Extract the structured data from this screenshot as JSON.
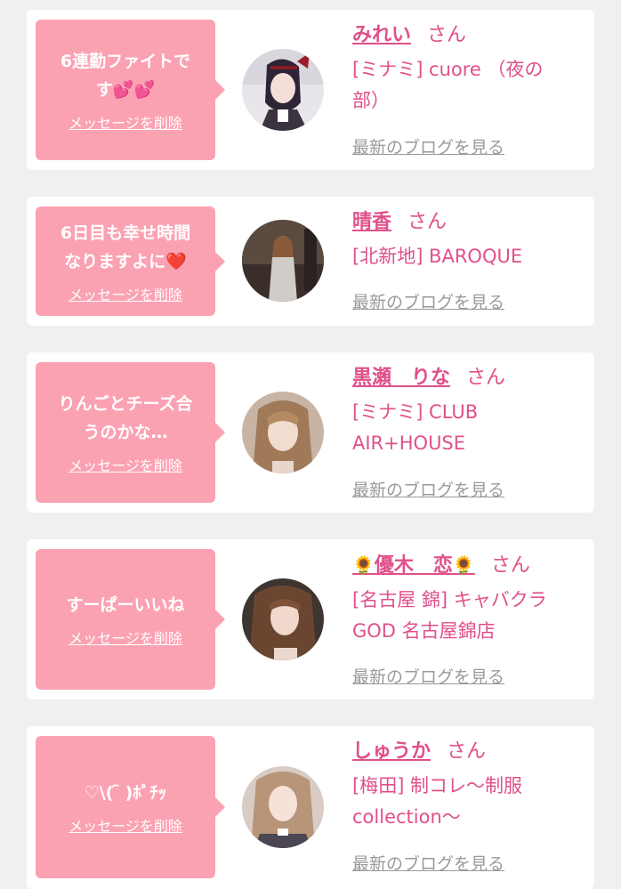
{
  "common": {
    "delete_label": "メッセージを削除",
    "blog_label": "最新のブログを見る",
    "san": "さん"
  },
  "cards": [
    {
      "message_line1": "6連勤ファイトで",
      "message_line2": "す💕💕",
      "name": "みれい",
      "shop_line1": "[ミナミ] cuore （夜の",
      "shop_line2": "部）"
    },
    {
      "message_line1": "6日目も幸せ時間",
      "message_line2": "なりますよに❤️",
      "name": "晴香",
      "shop_line1": "[北新地] BAROQUE",
      "shop_line2": ""
    },
    {
      "message_line1": "りんごとチーズ合",
      "message_line2": "うのかな…",
      "name": "黒瀬　りな",
      "shop_line1": "[ミナミ] CLUB",
      "shop_line2": "AIR+HOUSE"
    },
    {
      "message_line1": "すーぱーいいね",
      "message_line2": "",
      "name_prefix": "🌻",
      "name": "優木　恋",
      "name_suffix": "🌻",
      "shop_line1": "[名古屋 錦] キャバクラ",
      "shop_line2": "GOD 名古屋錦店"
    },
    {
      "message_line1": "♡\\( ᷇ )ﾎﾟﾁｯ",
      "message_line2": "",
      "name": "しゅうか",
      "shop_line1": "[梅田] 制コレ〜制服",
      "shop_line2": "collection〜"
    }
  ]
}
